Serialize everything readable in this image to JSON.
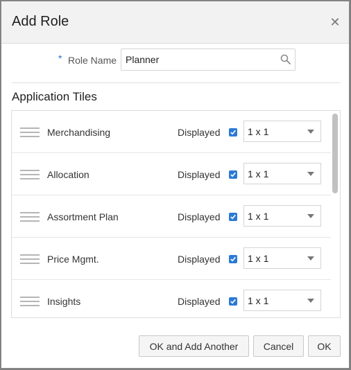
{
  "dialog": {
    "title": "Add Role",
    "close_icon": "close-icon"
  },
  "role": {
    "required_marker": "*",
    "label": "Role Name",
    "value": "Planner",
    "search_icon": "search-icon"
  },
  "section": {
    "title": "Application Tiles"
  },
  "tiles": [
    {
      "name": "Merchandising",
      "displayed_label": "Displayed",
      "checked": true,
      "size": "1 x 1"
    },
    {
      "name": "Allocation",
      "displayed_label": "Displayed",
      "checked": true,
      "size": "1 x 1"
    },
    {
      "name": "Assortment Plan",
      "displayed_label": "Displayed",
      "checked": true,
      "size": "1 x 1"
    },
    {
      "name": "Price Mgmt.",
      "displayed_label": "Displayed",
      "checked": true,
      "size": "1 x 1"
    },
    {
      "name": "Insights",
      "displayed_label": "Displayed",
      "checked": true,
      "size": "1 x 1"
    }
  ],
  "footer": {
    "ok_add_another_label": "OK and Add Another",
    "cancel_label": "Cancel",
    "ok_label": "OK"
  },
  "colors": {
    "accent": "#2a7ad5",
    "header_bg": "#f2f2f2"
  }
}
